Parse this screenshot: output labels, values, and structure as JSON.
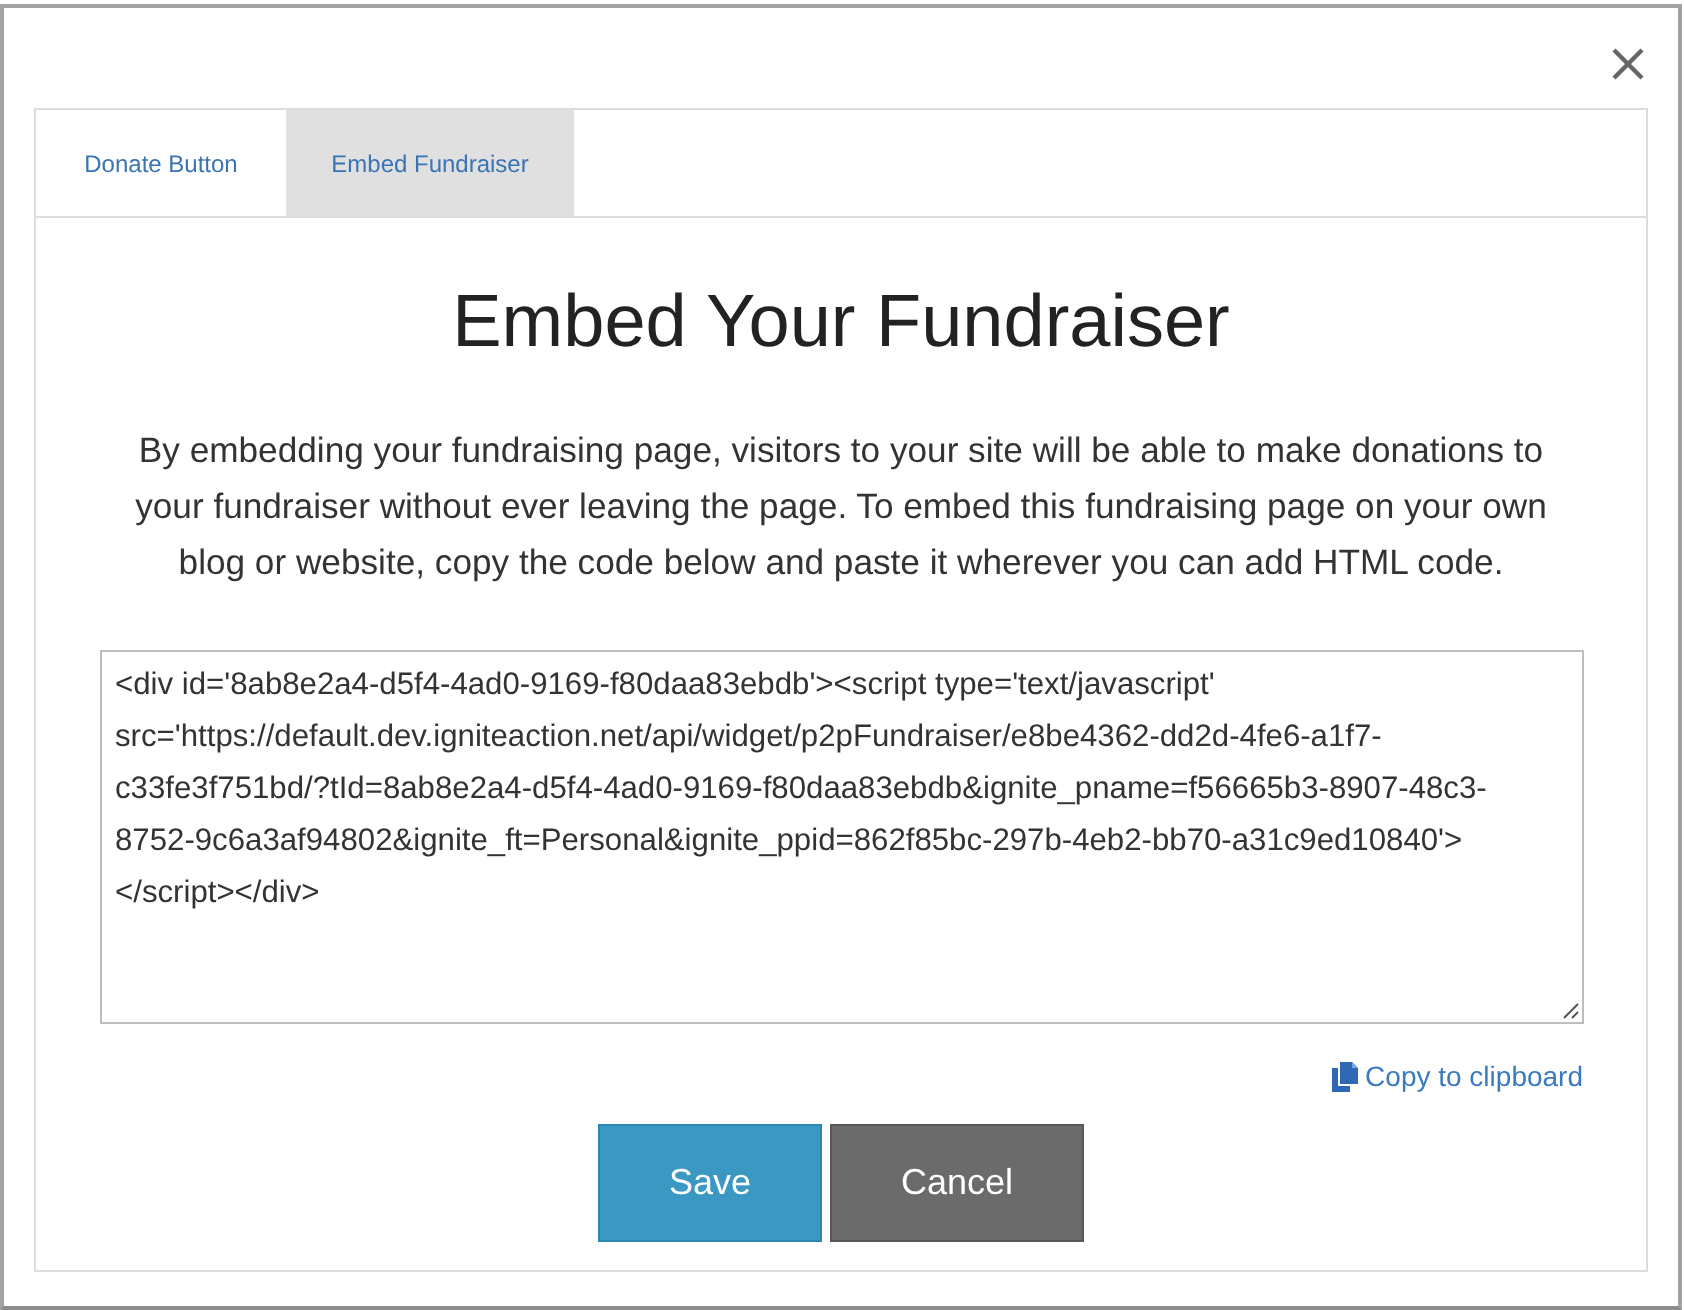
{
  "tabs": [
    {
      "label": "Donate Button",
      "selected": false
    },
    {
      "label": "Embed Fundraiser",
      "selected": true
    }
  ],
  "title": "Embed Your Fundraiser",
  "description": "By embedding your fundraising page, visitors to your site will be able to make donations to your fundraiser without ever leaving the page. To embed this fundraising page on your own blog or website, copy the code below and paste it wherever you can add HTML code.",
  "embed_code": {
    "value": "<div id='8ab8e2a4-d5f4-4ad0-9169-f80daa83ebdb'><script type='text/javascript' src='https://default.dev.igniteaction.net/api/widget/p2pFundraiser/e8be4362-dd2d-4fe6-a1f7-c33fe3f751bd/?tId=8ab8e2a4-d5f4-4ad0-9169-f80daa83ebdb&ignite_pname=f56665b3-8907-48c3-8752-9c6a3af94802&ignite_ft=Personal&ignite_ppid=862f85bc-297b-4eb2-bb70-a31c9ed10840'></script></div>"
  },
  "copy_link": {
    "label": "Copy to clipboard"
  },
  "buttons": [
    {
      "label": "Save",
      "kind": "primary"
    },
    {
      "label": "Cancel",
      "kind": "secondary"
    }
  ]
}
